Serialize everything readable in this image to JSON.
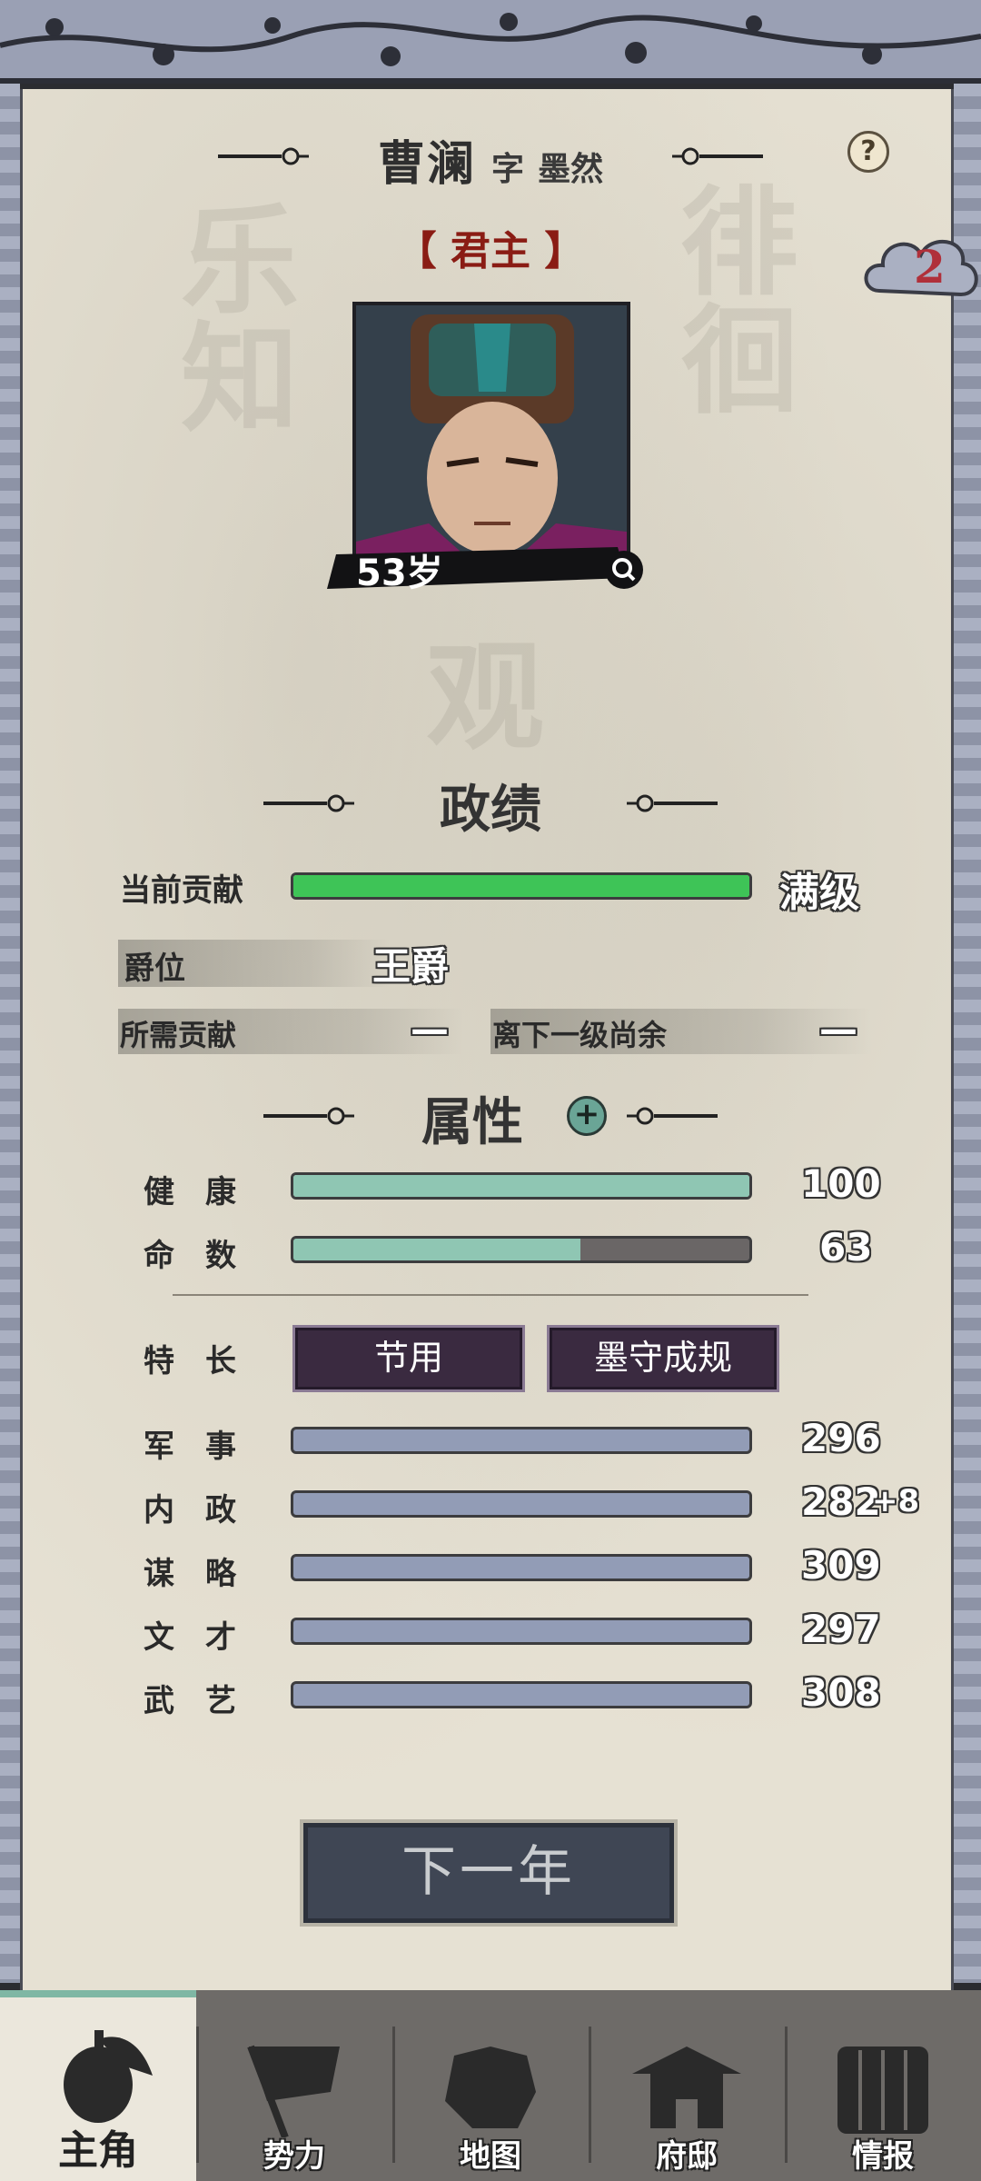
{
  "header": {
    "name": "曹澜",
    "zi_label": "字",
    "courtesy_name": "墨然",
    "help_label": "?",
    "notification_count": "2"
  },
  "character": {
    "rank": "君主",
    "rank_open": "【",
    "rank_close": "】",
    "age": "53岁"
  },
  "achievements": {
    "title": "政绩",
    "contribution_label": "当前贡献",
    "contribution_value": "满级",
    "contribution_progress": 1.0,
    "title_label": "爵位",
    "title_value": "王爵",
    "required_label": "所需贡献",
    "required_value": "—",
    "remaining_label": "离下一级尚余",
    "remaining_value": "—"
  },
  "attributes": {
    "title": "属性",
    "health_label": "健　康",
    "health_value": "100",
    "health_progress": 1.0,
    "fate_label": "命　数",
    "fate_value": "63",
    "fate_progress": 0.63,
    "specialty_label": "特　长",
    "traits": [
      "节用",
      "墨守成规"
    ],
    "stats": [
      {
        "label": "军　事",
        "value": "296",
        "bonus": ""
      },
      {
        "label": "内　政",
        "value": "282",
        "bonus": "+8"
      },
      {
        "label": "谋　略",
        "value": "309",
        "bonus": ""
      },
      {
        "label": "文　才",
        "value": "297",
        "bonus": ""
      },
      {
        "label": "武　艺",
        "value": "308",
        "bonus": ""
      }
    ]
  },
  "actions": {
    "next_year": "下一年"
  },
  "nav": {
    "items": [
      {
        "label": "主角",
        "icon": "protagonist-icon"
      },
      {
        "label": "势力",
        "icon": "flag-icon"
      },
      {
        "label": "地图",
        "icon": "map-icon"
      },
      {
        "label": "府邸",
        "icon": "mansion-icon"
      },
      {
        "label": "情报",
        "icon": "scroll-icon"
      }
    ]
  },
  "colors": {
    "contribution_bar": "#3ec457",
    "health_bar": "#8fc6b3",
    "stat_bar": "#929cb6",
    "rank_text": "#8a1c14",
    "trait_button": "#3a2a40"
  }
}
